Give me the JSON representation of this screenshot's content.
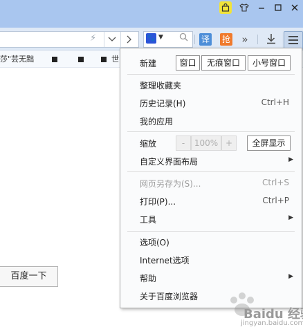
{
  "toolbar": {
    "translate_label": "译",
    "grab_label": "抢"
  },
  "bookmarks": [
    {
      "label": "莎\"芸无黜"
    },
    {
      "label": "世"
    }
  ],
  "page": {
    "search_button_label": "百度一下"
  },
  "menu": {
    "new_label": "新建",
    "new_buttons": [
      "窗口",
      "无痕窗口",
      "小号窗口"
    ],
    "items_group1": [
      {
        "label": "整理收藏夹",
        "shortcut": ""
      },
      {
        "label": "历史记录(H)",
        "shortcut": "Ctrl+H"
      },
      {
        "label": "我的应用",
        "shortcut": ""
      }
    ],
    "zoom_label": "缩放",
    "zoom_minus": "-",
    "zoom_value": "100%",
    "zoom_plus": "+",
    "fullscreen_label": "全屏显示",
    "customize_label": "自定义界面布局",
    "save_as": {
      "label": "网页另存为(S)...",
      "shortcut": "Ctrl+S"
    },
    "print": {
      "label": "打印(P)...",
      "shortcut": "Ctrl+P"
    },
    "tools_label": "工具",
    "options_label": "选项(O)",
    "internet_label": "Internet选项",
    "help_label": "帮助",
    "about_label": "关于百度浏览器"
  },
  "watermark": {
    "text": "Baidu 经验",
    "sub": "jingyan.baidu.com"
  }
}
